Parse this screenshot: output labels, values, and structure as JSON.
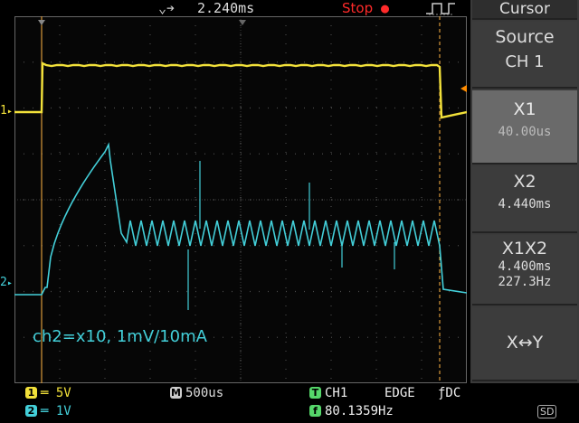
{
  "header": {
    "delay": "2.240ms",
    "run_state": "Stop",
    "trigger_edge_icon": "pulse-icon",
    "menu_title": "Cursor"
  },
  "annotation": "ch2=x10, 1mV/10mA",
  "channel_markers": {
    "ch1": "1",
    "ch2": "2"
  },
  "menu": {
    "source_label": "Source",
    "source_value": "CH 1",
    "x1_label": "X1",
    "x1_value": "40.00us",
    "x2_label": "X2",
    "x2_value": "4.440ms",
    "delta_label": "X1X2",
    "delta_time": "4.400ms",
    "delta_freq": "227.3Hz",
    "swap_label": "X↔Y"
  },
  "footer": {
    "ch1_num": "1",
    "ch1_scale": "═ 5V",
    "ch2_num": "2",
    "ch2_scale": "═ 1V",
    "timebase_icon": "M",
    "timebase": "500us",
    "trig_icon": "T",
    "trig_source": "CH1",
    "trig_type": "EDGE",
    "trig_coupling": "ƒDC",
    "freq_icon": "f",
    "frequency": "80.1359Hz",
    "storage_badge": "SD"
  },
  "colors": {
    "ch1": "#f2e13a",
    "ch2": "#43cfd9",
    "trigger_marker": "#ff8c00",
    "cursor": "#d99a3a",
    "stop": "#ff2a2a",
    "grid": "#5a5a5a"
  }
}
